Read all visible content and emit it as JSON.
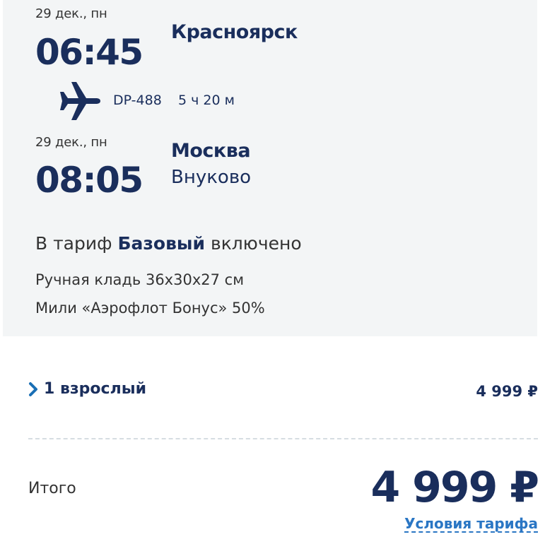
{
  "departure": {
    "date": "29 дек., пн",
    "time": "06:45",
    "city": "Красноярск"
  },
  "flight": {
    "number": "DP-488",
    "duration": "5 ч 20 м",
    "icon": "airplane-icon"
  },
  "arrival": {
    "date": "29 дек., пн",
    "time": "08:05",
    "city": "Москва",
    "airport": "Внуково"
  },
  "tariff": {
    "prefix": "В тариф",
    "name": "Базовый",
    "suffix": "включено",
    "includes": [
      "Ручная кладь 36х30х27 см",
      "Мили «Аэрофлот Бонус» 50%"
    ]
  },
  "passengers": {
    "label": "1 взрослый",
    "price": "4 999 ₽",
    "icon": "chevron-right-icon"
  },
  "total": {
    "label": "Итого",
    "price": "4 999 ₽",
    "terms_link": "Условия тарифа"
  },
  "colors": {
    "primary": "#1a2e5c",
    "link": "#2a76c4",
    "card_bg": "#f3f5f6"
  }
}
